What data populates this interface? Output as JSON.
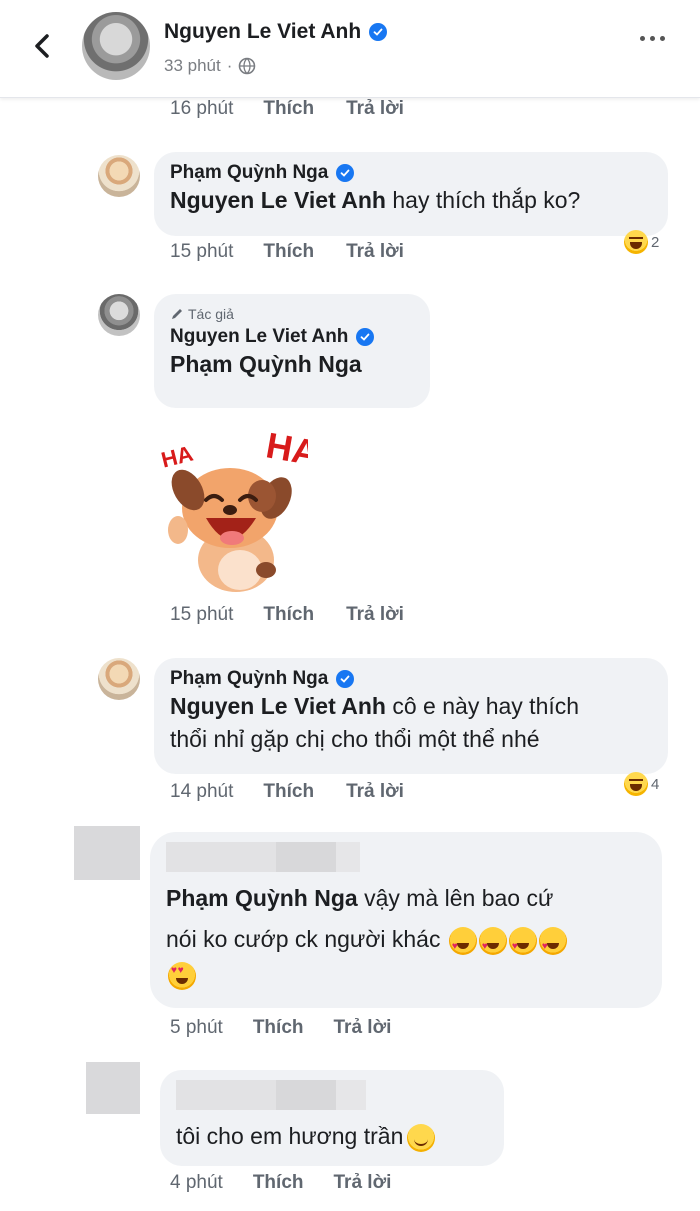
{
  "header": {
    "name": "Nguyen Le Viet Anh",
    "time": "33 phút",
    "separator": "·"
  },
  "top_actions": {
    "time": "16 phút",
    "like": "Thích",
    "reply": "Trả lời"
  },
  "comments": [
    {
      "author": "Phạm Quỳnh Nga",
      "tag": "Nguyen Le Viet Anh",
      "text": " hay thích thắp ko?",
      "time": "15 phút",
      "like": "Thích",
      "reply": "Trả lời",
      "reaction_count": "2"
    },
    {
      "badge": "Tác giả",
      "author": "Nguyen Le Viet Anh",
      "text": "Phạm Quỳnh Nga",
      "sticker": "HA HA",
      "time": "15 phút",
      "like": "Thích",
      "reply": "Trả lời"
    },
    {
      "author": "Phạm Quỳnh Nga",
      "tag": "Nguyen Le Viet Anh",
      "text_line1": " cô e này hay thích",
      "text_line2": "thổi nhỉ gặp chị cho thổi một thể nhé",
      "time": "14 phút",
      "like": "Thích",
      "reply": "Trả lời",
      "reaction_count": "4"
    },
    {
      "tag": "Phạm Quỳnh Nga",
      "text_line1": "  vậy mà lên bao cứ",
      "text_line2": "nói ko cướp ck người khác",
      "time": "5 phút",
      "like": "Thích",
      "reply": "Trả lời"
    },
    {
      "text": "tôi cho em hương trần",
      "time": "4 phút",
      "like": "Thích",
      "reply": "Trả lời"
    }
  ],
  "colors": {
    "verified": "#1877f2",
    "bubble": "#f0f2f5",
    "meta": "#606770"
  }
}
